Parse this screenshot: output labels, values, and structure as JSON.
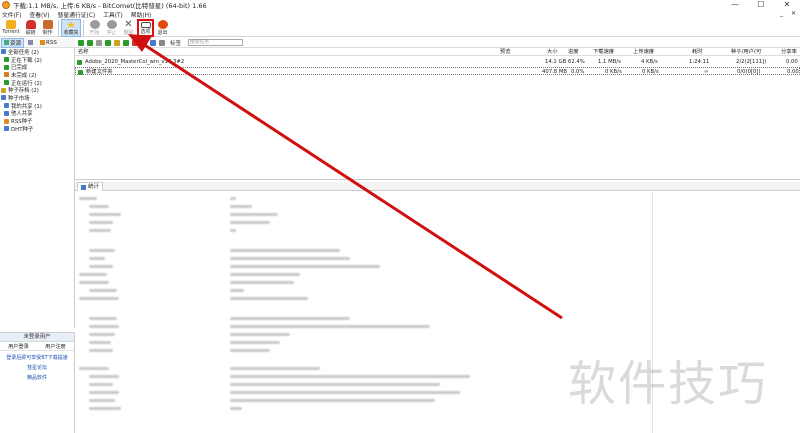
{
  "window": {
    "title": "下载:1.1 MB/s, 上传:6 KB/s - BitComet(比特彗星) (64-bit) 1.66",
    "controls": [
      "—",
      "☐",
      "✕"
    ]
  },
  "menu": [
    "文件(F)",
    "查看(V)",
    "彗星通行证(C)",
    "工具(T)",
    "帮助(H)"
  ],
  "menu_right": [
    "_",
    "✕"
  ],
  "toolbar": [
    {
      "label": "Torrent",
      "color": "#f2b01e"
    },
    {
      "label": "磁链",
      "color": "#d2302a"
    },
    {
      "label": "制作",
      "color": "#c86a2a"
    },
    {
      "label": "收藏夹",
      "color": "#f0c030"
    },
    {
      "label": "开始",
      "color": "#9a9a9a"
    },
    {
      "label": "停止",
      "color": "#9a9a9a"
    },
    {
      "label": "删除",
      "color": "#9a9a9a"
    },
    {
      "label": "选项",
      "color": "#4a4a4a"
    },
    {
      "label": "退出",
      "color": "#e04a10"
    }
  ],
  "subbar_left": [
    "资源",
    "  ",
    "RSS"
  ],
  "subbar": {
    "filter_label": "标签",
    "search_placeholder": "搜索任务"
  },
  "sidebar": {
    "items": [
      {
        "label": "全部任务 (2)",
        "level": 0,
        "color": "#4a7acd"
      },
      {
        "label": "正在下载 (2)",
        "level": 1,
        "color": "#2a9a2a"
      },
      {
        "label": "已完成",
        "level": 1,
        "color": "#2a9a2a"
      },
      {
        "label": "未完成 (2)",
        "level": 1,
        "color": "#d08020"
      },
      {
        "label": "正在运行 (2)",
        "level": 1,
        "color": "#2a9a2a"
      },
      {
        "label": "种子存档 (2)",
        "level": 0,
        "color": "#d0a020"
      },
      {
        "label": "种子市场",
        "level": 0,
        "color": "#4a7acd"
      },
      {
        "label": "我的共享 (1)",
        "level": 1,
        "color": "#4a7acd"
      },
      {
        "label": "他人共享",
        "level": 1,
        "color": "#4a7acd"
      },
      {
        "label": "RSS种子",
        "level": 1,
        "color": "#e08a20"
      },
      {
        "label": "DHT种子",
        "level": 1,
        "color": "#4a7acd"
      }
    ]
  },
  "login_panel": {
    "header": "未登录用户",
    "login": "用户登录",
    "register": "用户注册",
    "promo": "登录后即可享受BT下载提速",
    "links": [
      "彗星论坛",
      "精品软件"
    ]
  },
  "list": {
    "columns": [
      "名称",
      "预览",
      "大小",
      "进度",
      "下载速度",
      "上传速度",
      "耗时",
      "种子/用户(可",
      "分享率"
    ],
    "rows": [
      {
        "name": "Adobe_2020_MasterCol_win_v10.3#2",
        "preview": "",
        "size": "14.1 GB",
        "progress": "62.4%",
        "down": "1.1 MB/s",
        "up": "4 KB/s",
        "time": "1:24:11",
        "seeds": "2/2(2[111])",
        "ratio": "0.00"
      },
      {
        "name": "新建文件夹",
        "preview": "",
        "size": "407.8 MB",
        "progress": "0.0%",
        "down": "0 KB/s",
        "up": "0 KB/s",
        "time": "∞",
        "seeds": "0/0(0[0])",
        "ratio": "0.00"
      }
    ]
  },
  "stats_tab": {
    "label": "统计"
  },
  "watermark": "软件技巧",
  "colors": {
    "arrow": "#d01010",
    "highlight": "#e01010",
    "selection": "#cfe3f7"
  }
}
